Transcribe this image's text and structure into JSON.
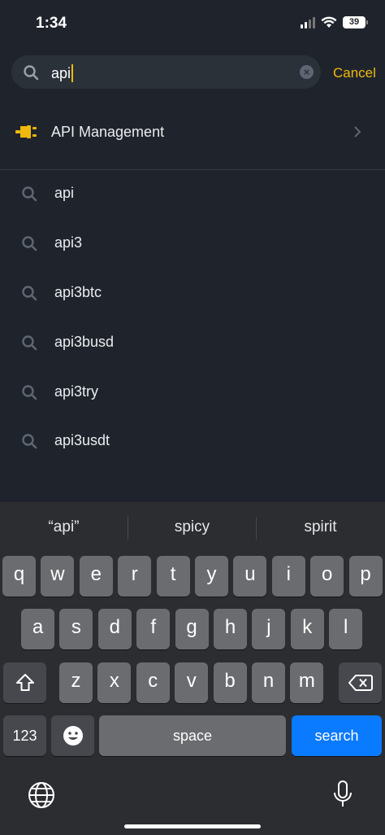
{
  "status_bar": {
    "time": "1:34",
    "battery": "39"
  },
  "search": {
    "value": "api",
    "cancel_label": "Cancel"
  },
  "top_result": {
    "label": "API Management"
  },
  "history": [
    "api",
    "api3",
    "api3btc",
    "api3busd",
    "api3try",
    "api3usdt"
  ],
  "keyboard": {
    "predictions": [
      "“api”",
      "spicy",
      "spirit"
    ],
    "row1": [
      "q",
      "w",
      "e",
      "r",
      "t",
      "y",
      "u",
      "i",
      "o",
      "p"
    ],
    "row2": [
      "a",
      "s",
      "d",
      "f",
      "g",
      "h",
      "j",
      "k",
      "l"
    ],
    "row3": [
      "z",
      "x",
      "c",
      "v",
      "b",
      "n",
      "m"
    ],
    "numbers_label": "123",
    "space_label": "space",
    "search_label": "search"
  },
  "colors": {
    "accent": "#f0b90b",
    "background": "#1f242c",
    "search_key": "#0a7aff"
  }
}
